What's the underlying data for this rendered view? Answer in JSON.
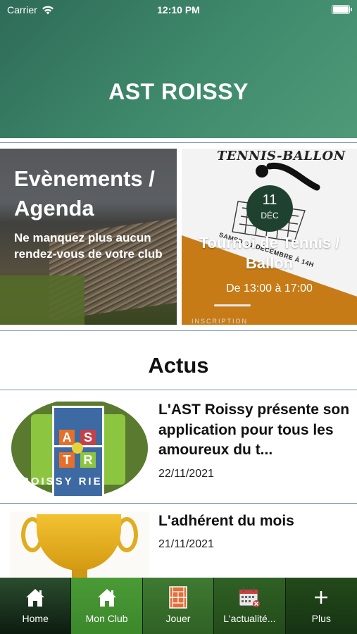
{
  "status_bar": {
    "carrier": "Carrier",
    "time": "12:10 PM"
  },
  "header": {
    "title": "AST ROISSY"
  },
  "agenda_card": {
    "title": "Evènements / Agenda",
    "subtitle": "Ne manquez plus aucun rendez-vous de votre club"
  },
  "event_card": {
    "artwork_title": "TENNIS-BALLON",
    "artwork_subtitle": "SAMEDI 11 DÉCEMBRE À 14H",
    "day": "11",
    "month": "DÉC",
    "title": "Tournoi de Tennis / Ballon",
    "time": "De 13:00 à 17:00",
    "inscription": "INSCRIPTION"
  },
  "actus": {
    "title": "Actus",
    "items": [
      {
        "title": "L'AST Roissy présente son application pour tous les amoureux du t...",
        "date": "22/11/2021",
        "logo_letters": [
          "A",
          "S",
          "T",
          "R"
        ],
        "logo_ring_text": "ROISSY   RIE"
      },
      {
        "title": "L'adhérent du mois",
        "date": "21/11/2021"
      }
    ]
  },
  "tabbar": {
    "items": [
      {
        "label": "Home",
        "icon": "home-icon"
      },
      {
        "label": "Mon Club",
        "icon": "club-home-icon",
        "active": true
      },
      {
        "label": "Jouer",
        "icon": "tennis-court-icon"
      },
      {
        "label": "L'actualité...",
        "icon": "calendar-icon"
      },
      {
        "label": "Plus",
        "icon": "plus-icon"
      }
    ]
  },
  "colors": {
    "header_start": "#2e6b58",
    "header_end": "#4e9a78",
    "tab_active": "#4a9a36",
    "tabbar_bg": "#1e3a24",
    "date_badge": "#1f4230",
    "event_orange": "#c77b16"
  }
}
